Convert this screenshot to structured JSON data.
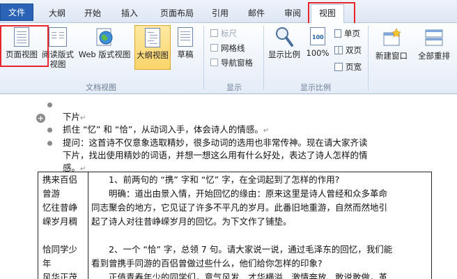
{
  "tabs": {
    "file": "文件",
    "outline": "大纲",
    "home": "开始",
    "insert": "插入",
    "layout": "页面布局",
    "references": "引用",
    "mailings": "邮件",
    "review": "审阅",
    "view": "视图"
  },
  "ribbon": {
    "print_layout": "页面视图",
    "reading_layout_1": "阅读版式",
    "reading_layout_2": "视图",
    "web_layout": "Web 版式视图",
    "outline_view": "大纲视图",
    "draft": "草稿",
    "group_doc_views": "文档视图",
    "ruler": "标尺",
    "gridlines": "网格线",
    "nav_pane": "导航窗格",
    "group_show": "显示",
    "zoom": "显示比例",
    "zoom100": "100%",
    "one_page": "单页",
    "two_pages": "双页",
    "page_width": "页宽",
    "group_zoom": "显示比例",
    "new_window": "新建窗口",
    "arrange_all": "全部重排"
  },
  "doc": {
    "heading": "下片",
    "b1": "抓住 “忆” 和 “恰”，从动词入手，体会诗人的情感。",
    "b2_l1": "提问：这首诗不仅意象选取精妙，很多动词的选用也非常传神。现在请大家齐读",
    "b2_l2": "下片，找出使用精妙的词语，并想一想这么用有什么好处，表达了诗人怎样的情",
    "b2_l3": "感。",
    "para_mark": "↵"
  },
  "table": {
    "left": [
      "携来百侣",
      "曾游",
      "忆往昔峥",
      "嵘岁月稠",
      "",
      "恰同学少",
      "年",
      "风华正茂"
    ],
    "right": [
      "　　1、前两句的 “携” 字和 “忆” 字，在全词起到了怎样的作用?",
      "　　明确：道出由景入情，开始回忆的缘由：原来这里是诗人曾经和众多革命",
      "同志聚会的地方，它见证了许多不平凡的岁月。此番旧地重游，自然而然地引",
      "起了诗人对往昔峥嵘岁月的回忆。为下文作了铺垫。",
      "",
      "　　2、一个 “恰” 字，总领 7 句。请大家说一说，通过毛泽东的回忆，我们能",
      "看到曾携手同游的百侣曾做过些什么，他们给你怎样的印象?",
      "　　正值青春年少的同学们，意气风发、才华横溢、激情奔放、敢说敢做，革"
    ]
  }
}
